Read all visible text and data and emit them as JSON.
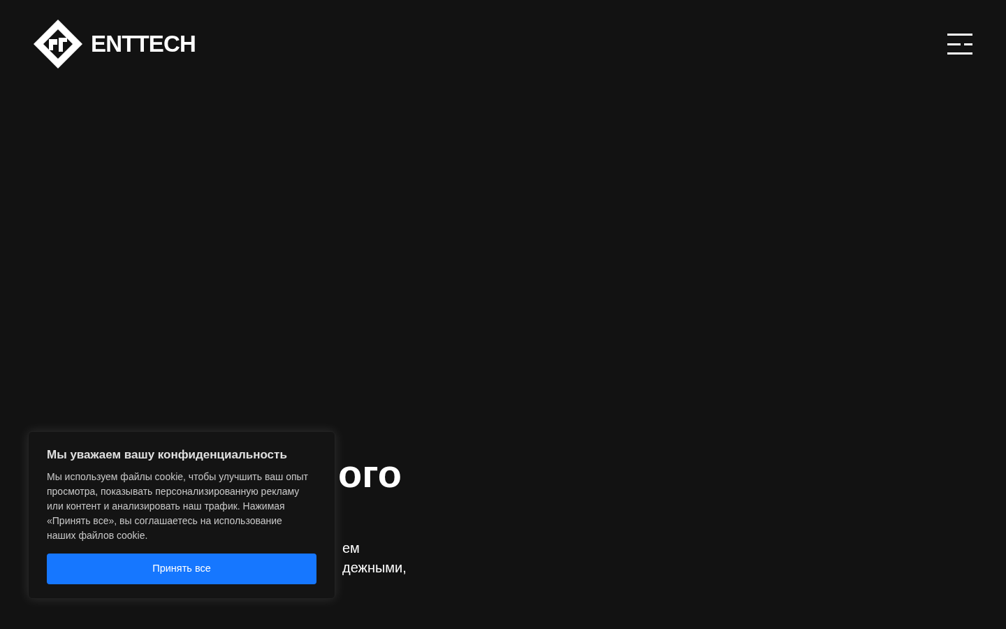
{
  "header": {
    "logo_text": "ENTTECH"
  },
  "hero": {
    "title_line_2_fragment": "ого",
    "text_fragments": [
      "ем",
      "дежными,"
    ]
  },
  "cookie_banner": {
    "title": "Мы уважаем вашу конфиденциальность",
    "text": "Мы используем файлы cookie, чтобы улучшить ваш опыт просмотра, показывать персонализированную рекламу или контент и анализировать наш трафик. Нажимая «Принять все», вы соглашаетесь на использование наших файлов cookie.",
    "button": "Принять все"
  }
}
